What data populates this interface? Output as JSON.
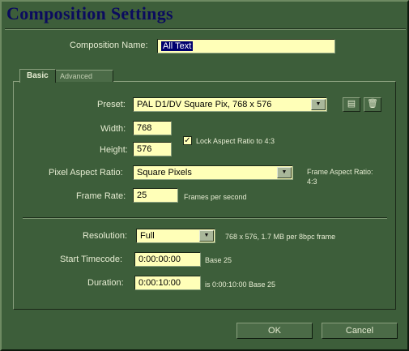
{
  "window": {
    "title": "Composition Settings"
  },
  "comp_name": {
    "label": "Composition Name:",
    "value": "All Text"
  },
  "tabs": [
    {
      "label": "Basic",
      "active": true
    },
    {
      "label": "Advanced",
      "active": false
    }
  ],
  "basic": {
    "preset": {
      "label": "Preset:",
      "value": "PAL D1/DV Square Pix, 768 x 576"
    },
    "width": {
      "label": "Width:",
      "value": "768"
    },
    "height": {
      "label": "Height:",
      "value": "576"
    },
    "lock_aspect": {
      "label": "Lock Aspect Ratio to 4:3",
      "checked": true
    },
    "pixel_aspect": {
      "label": "Pixel Aspect Ratio:",
      "value": "Square Pixels"
    },
    "frame_aspect": {
      "label": "Frame Aspect Ratio:",
      "value": "4:3"
    },
    "frame_rate": {
      "label": "Frame Rate:",
      "value": "25",
      "unit": "Frames per second"
    },
    "resolution": {
      "label": "Resolution:",
      "value": "Full",
      "info": "768 x 576, 1.7 MB per 8bpc frame"
    },
    "start_timecode": {
      "label": "Start Timecode:",
      "value": "0:00:00:00",
      "info": "Base 25"
    },
    "duration": {
      "label": "Duration:",
      "value": "0:00:10:00",
      "info": "is 0:00:10:00  Base 25"
    }
  },
  "buttons": {
    "ok": "OK",
    "cancel": "Cancel"
  },
  "icons": {
    "preset_save": "save-preset-icon",
    "preset_delete": "trash-icon",
    "dropdown": "triangle-down-icon"
  },
  "colors": {
    "background": "#3d5e3a",
    "field": "#ffffb8",
    "title": "#0b0b5e",
    "selection": "#00006e"
  }
}
